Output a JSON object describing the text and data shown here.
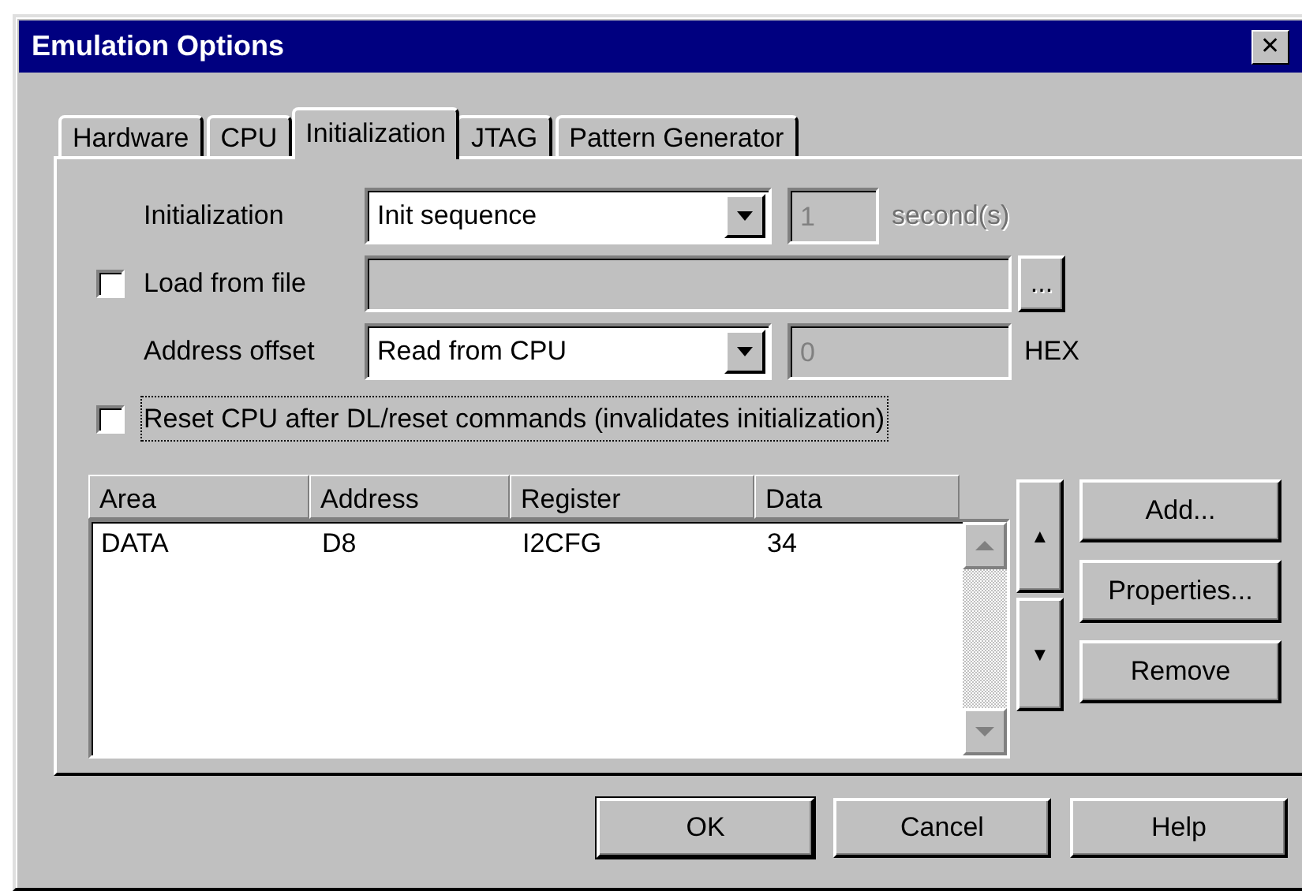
{
  "window": {
    "title": "Emulation Options",
    "close": "✕"
  },
  "tabs": [
    {
      "label": "Hardware",
      "selected": false
    },
    {
      "label": "CPU",
      "selected": false
    },
    {
      "label": "Initialization",
      "selected": true
    },
    {
      "label": "JTAG",
      "selected": false
    },
    {
      "label": "Pattern Generator",
      "selected": false
    }
  ],
  "initialization": {
    "label": "Initialization",
    "value": "Init sequence",
    "delay": {
      "value": "1",
      "disabled": true
    },
    "delay_unit": {
      "text": "second(s)",
      "disabled": true
    }
  },
  "load_from_file": {
    "label": "Load from file",
    "checked": false,
    "path": {
      "disabled": true
    },
    "browse": {
      "label": "...",
      "disabled": true
    }
  },
  "address_offset": {
    "label": "Address offset",
    "value": "Read from CPU",
    "offset": {
      "value": "0",
      "disabled": true
    },
    "unit": "HEX"
  },
  "reset_cpu": {
    "label": "Reset CPU after DL/reset commands (invalidates initialization)",
    "checked": false,
    "focused": true
  },
  "table": {
    "columns": [
      "Area",
      "Address",
      "Register",
      "Data"
    ],
    "rows": [
      [
        "DATA",
        "D8",
        "I2CFG",
        "34"
      ]
    ]
  },
  "move_buttons": [
    "▲",
    "▼"
  ],
  "side_buttons": [
    "Add...",
    "Properties...",
    "Remove"
  ],
  "buttons": [
    {
      "label": "OK",
      "default": true
    },
    {
      "label": "Cancel",
      "default": false
    },
    {
      "label": "Help",
      "default": false
    }
  ]
}
